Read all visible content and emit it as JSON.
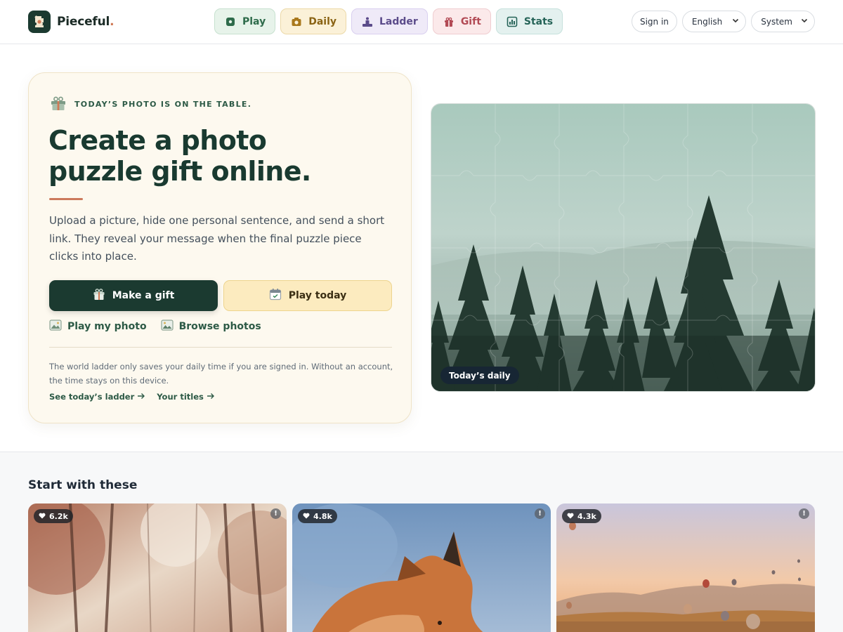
{
  "brand": {
    "name": "Pieceful",
    "dot": "."
  },
  "nav": [
    {
      "label": "Play"
    },
    {
      "label": "Daily"
    },
    {
      "label": "Ladder"
    },
    {
      "label": "Gift"
    },
    {
      "label": "Stats"
    }
  ],
  "header": {
    "sign_in": "Sign in",
    "language": "English",
    "theme": "System"
  },
  "hero": {
    "eyebrow": "TODAY’S PHOTO IS ON THE TABLE.",
    "title_line1": "Create a photo",
    "title_line2": "puzzle gift online.",
    "description": "Upload a picture, hide one personal sentence, and send a short link. They reveal your message when the final puzzle piece clicks into place.",
    "primary_button": "Make a gift",
    "secondary_button": "Play today",
    "link_play_photo": "Play my photo",
    "link_browse": "Browse photos",
    "note": "The world ladder only saves your daily time if you are signed in. Without an account, the time stays on this device.",
    "link_ladder": "See today’s ladder",
    "link_titles": "Your titles",
    "image_badge": "Today’s daily"
  },
  "section": {
    "title": "Start with these",
    "cards": [
      {
        "likes": "6.2k",
        "icon": "heart-icon"
      },
      {
        "likes": "4.8k",
        "icon": "heart-icon"
      },
      {
        "likes": "4.3k",
        "icon": "heart-icon"
      }
    ]
  },
  "colors": {
    "brand_dark": "#1b3a30",
    "accent": "#cc7a5c",
    "card_bg": "#fdf9ef"
  }
}
